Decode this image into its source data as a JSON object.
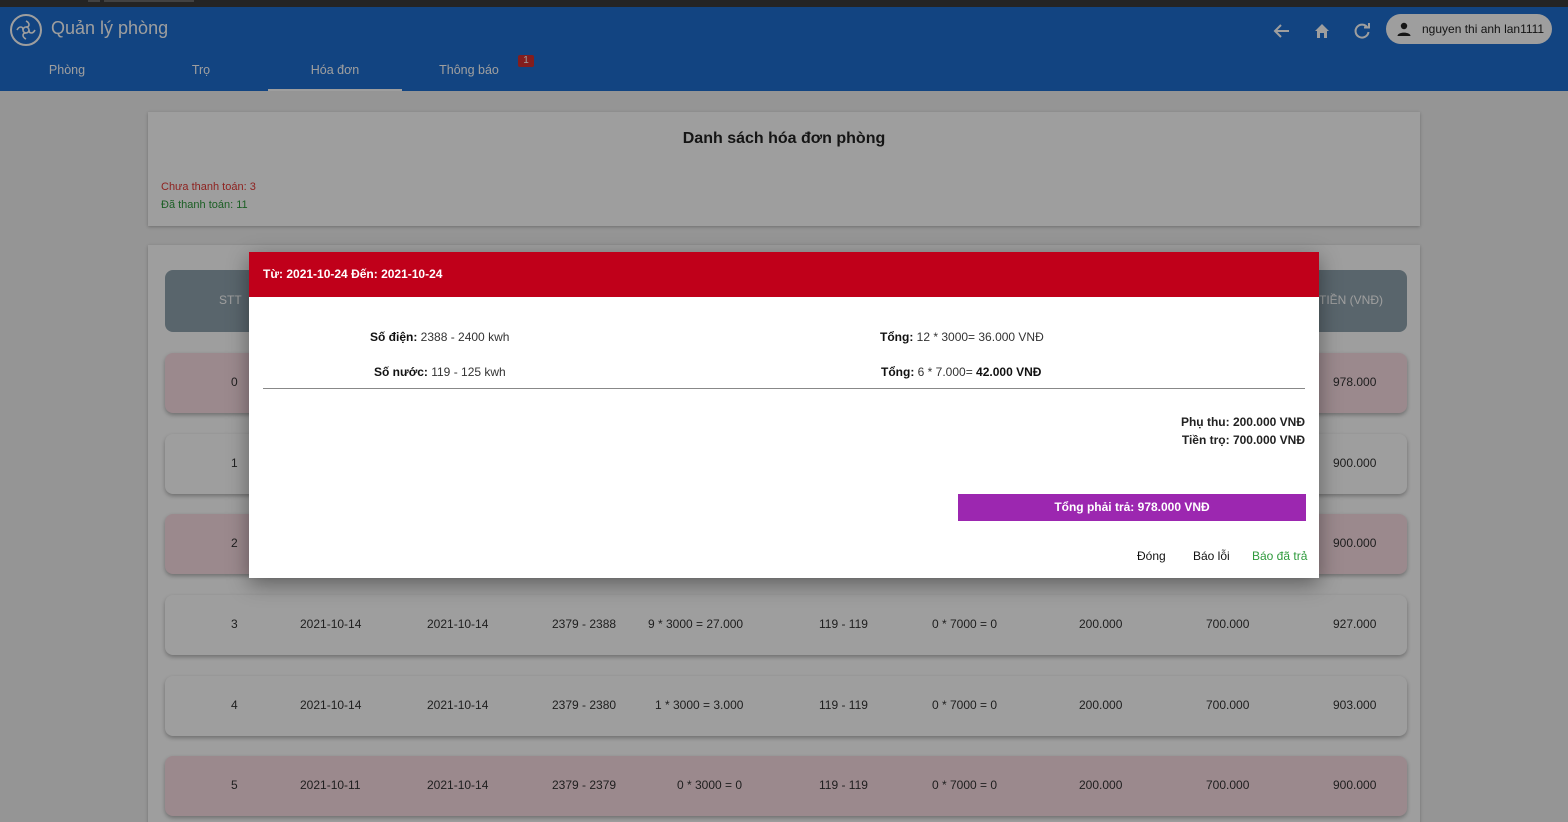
{
  "app": {
    "title": "Quản lý phòng",
    "user_name": "nguyen thi anh lan1111"
  },
  "nav": {
    "tabs": [
      {
        "label": "Phòng"
      },
      {
        "label": "Trọ"
      },
      {
        "label": "Hóa đơn"
      },
      {
        "label": "Thông báo"
      }
    ],
    "active_tab": "Hóa đơn",
    "notif_count": "1"
  },
  "toolbar_icons": [
    "back-arrow-icon",
    "home-icon",
    "refresh-icon",
    "account-icon"
  ],
  "summary": {
    "title": "Danh sách hóa đơn phòng",
    "unpaid": "Chưa thanh toán: 3",
    "paid": "Đã thanh toán: 11"
  },
  "table": {
    "header_stt": "STT",
    "header_total": "TIỀN (VNĐ)",
    "rows": [
      {
        "stt": "0",
        "total": "978.000",
        "status": "unpaid"
      },
      {
        "stt": "1",
        "total": "900.000",
        "status": "paid"
      },
      {
        "stt": "2",
        "total": "900.000",
        "status": "unpaid"
      },
      {
        "stt": "3",
        "from": "2021-10-14",
        "to": "2021-10-14",
        "elec": "2379 - 2388",
        "elec_cost": "9 * 3000 = 27.000",
        "water": "119 - 119",
        "water_cost": "0 * 7000 = 0",
        "surcharge": "200.000",
        "rent": "700.000",
        "total": "927.000",
        "status": "paid"
      },
      {
        "stt": "4",
        "from": "2021-10-14",
        "to": "2021-10-14",
        "elec": "2379 - 2380",
        "elec_cost": "1 * 3000 = 3.000",
        "water": "119 - 119",
        "water_cost": "0 * 7000 = 0",
        "surcharge": "200.000",
        "rent": "700.000",
        "total": "903.000",
        "status": "paid"
      },
      {
        "stt": "5",
        "from": "2021-10-11",
        "to": "2021-10-14",
        "elec": "2379 - 2379",
        "elec_cost": "0 * 3000 = 0",
        "water": "119 - 119",
        "water_cost": "0 * 7000 = 0",
        "surcharge": "200.000",
        "rent": "700.000",
        "total": "900.000",
        "status": "unpaid"
      }
    ]
  },
  "dialog": {
    "header": "Từ: 2021-10-24 Đến: 2021-10-24",
    "elec_label": "Số điện:",
    "elec_value": " 2388 - 2400 kwh",
    "elec_total_label": "Tổng:",
    "elec_total_value": " 12 * 3000= 36.000 VNĐ",
    "water_label": "Số nước:",
    "water_value": " 119 - 125 kwh",
    "water_total_label": "Tổng:",
    "water_total_value": " 6 * 7.000= ",
    "water_total_amount": "42.000 VNĐ",
    "surcharge": "Phụ thu: 200.000 VNĐ",
    "rent": "Tiền trọ: 700.000 VNĐ",
    "total_due": "Tổng phải trả: 978.000 VNĐ",
    "buttons": {
      "close": "Đóng",
      "report_error": "Báo lỗi",
      "report_paid": "Báo đã trả"
    }
  },
  "colors": {
    "appbar": "#1e6fd1",
    "dialog_header": "#c0001a",
    "total_bar": "#9c27b0",
    "unpaid_text": "#e53935",
    "paid_text": "#2e9a3c",
    "unpaid_row": "#fbdde4"
  }
}
